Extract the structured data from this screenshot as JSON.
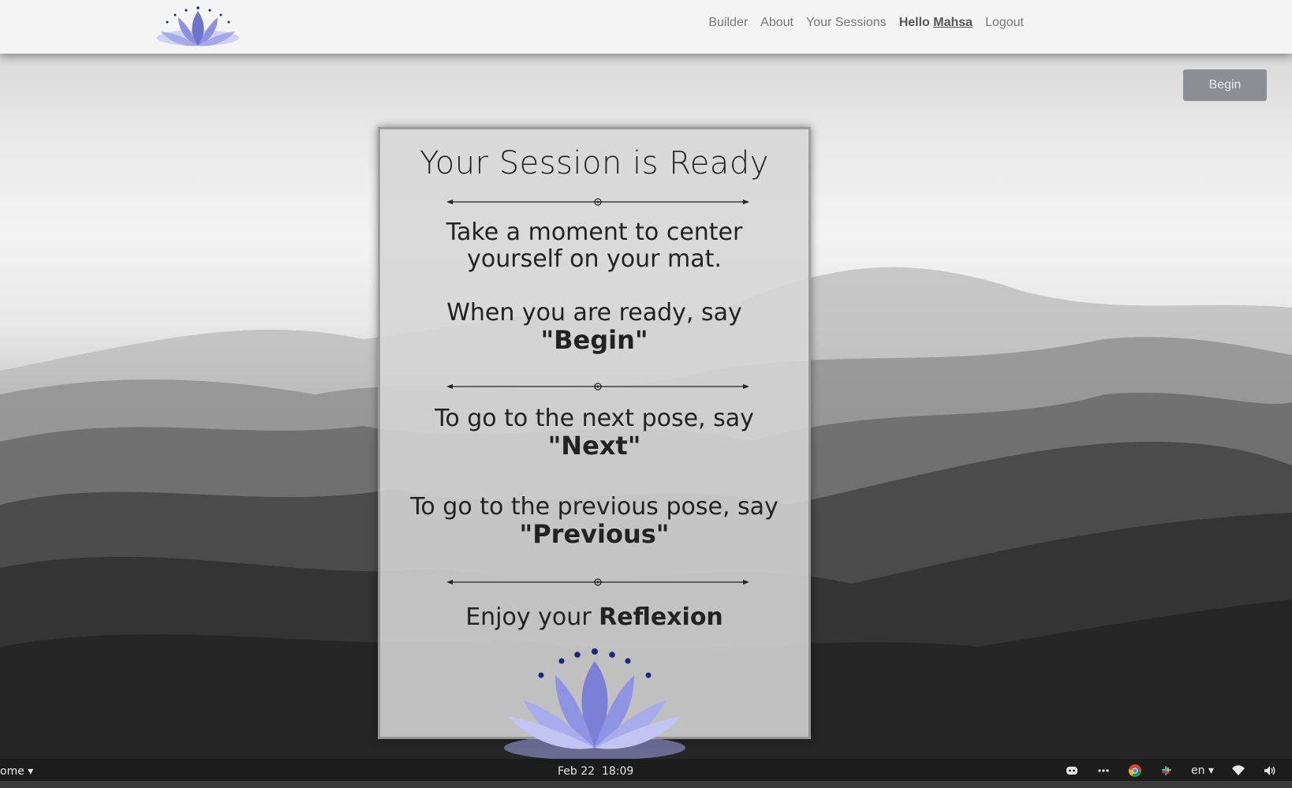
{
  "nav": {
    "items": [
      "Builder",
      "About",
      "Your Sessions"
    ],
    "hello_prefix": "Hello",
    "hello_user": "Mahsa",
    "logout": "Logout",
    "logo_icon": "lotus-logo-icon"
  },
  "actions": {
    "begin_label": "Begin"
  },
  "card": {
    "title": "Your Session is Ready",
    "center_text": "Take a moment to center yourself on your mat.",
    "ready_text": "When you are ready, say",
    "ready_cmd": "\"Begin\"",
    "next_text": "To go to the next pose, say",
    "next_cmd": "\"Next\"",
    "prev_text": "To go to the previous pose, say",
    "prev_cmd": "\"Previous\"",
    "enjoy_prefix": "Enjoy your",
    "enjoy_brand": "Reflexion"
  },
  "taskbar": {
    "app_label": "ome",
    "date": "Feb 22",
    "time": "18:09",
    "lang": "en"
  },
  "colors": {
    "lotus_light": "#b9bdf0",
    "lotus_mid": "#8c91e0",
    "lotus_dark": "#5e63c4",
    "dot": "#1b2a78"
  }
}
